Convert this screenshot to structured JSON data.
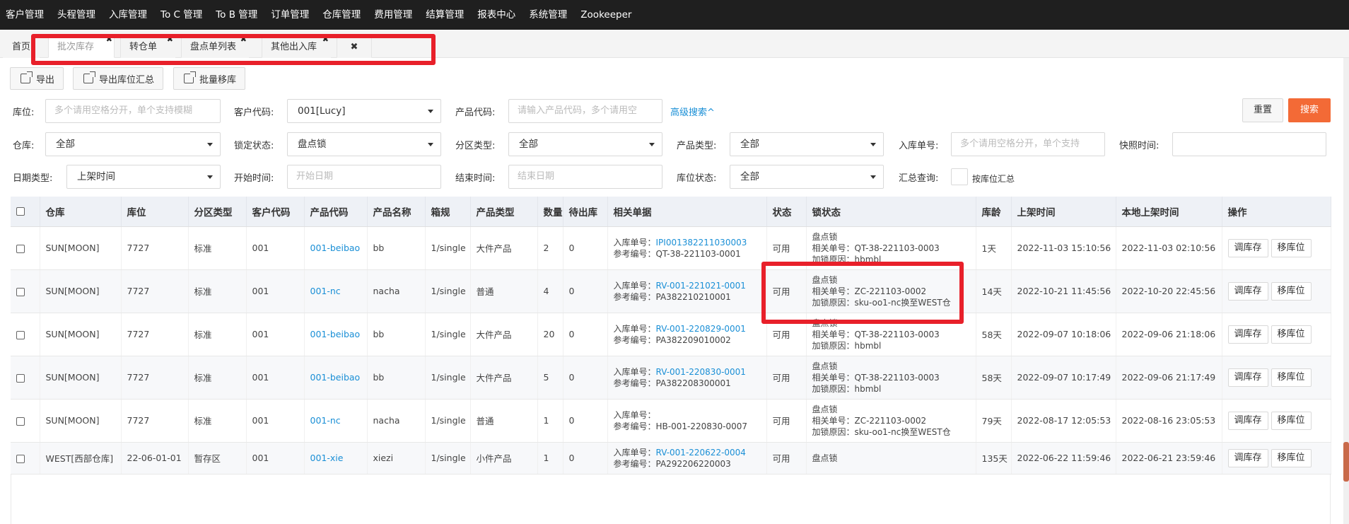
{
  "nav": [
    "客户管理",
    "头程管理",
    "入库管理",
    "To C 管理",
    "To B 管理",
    "订单管理",
    "仓库管理",
    "费用管理",
    "结算管理",
    "报表中心",
    "系统管理",
    "Zookeeper"
  ],
  "tabs": {
    "home": "首页",
    "items": [
      "批次库存",
      "转仓单",
      "盘点单列表",
      "其他出入库"
    ],
    "close_glyph": "✖"
  },
  "toolbar": {
    "export": "导出",
    "export_summary": "导出库位汇总",
    "batch_move": "批量移库"
  },
  "filters": {
    "location_label": "库位:",
    "location_placeholder": "多个请用空格分开，单个支持模糊",
    "customer_label": "客户代码:",
    "customer_value": "001[Lucy]",
    "product_code_label": "产品代码:",
    "product_code_placeholder": "请输入产品代码，多个请用空",
    "advanced_search": "高级搜索^",
    "reset": "重置",
    "search": "搜索",
    "warehouse_label": "仓库:",
    "warehouse_value": "全部",
    "lock_status_label": "锁定状态:",
    "lock_status_value": "盘点锁",
    "zone_type_label": "分区类型:",
    "zone_type_value": "全部",
    "product_type_label": "产品类型:",
    "product_type_value": "全部",
    "inbound_no_label": "入库单号:",
    "inbound_no_placeholder": "多个请用空格分开，单个支持",
    "snapshot_label": "快照时间:",
    "date_type_label": "日期类型:",
    "date_type_value": "上架时间",
    "start_label": "开始时间:",
    "start_placeholder": "开始日期",
    "end_label": "结束时间:",
    "end_placeholder": "结束日期",
    "loc_status_label": "库位状态:",
    "loc_status_value": "全部",
    "summary_label": "汇总查询:",
    "summary_option": "按库位汇总"
  },
  "table": {
    "headers": [
      "仓库",
      "库位",
      "分区类型",
      "客户代码",
      "产品代码",
      "产品名称",
      "箱规",
      "产品类型",
      "数量",
      "待出库",
      "相关单据",
      "状态",
      "锁状态",
      "库龄",
      "上架时间",
      "本地上架时间",
      "操作"
    ],
    "op_adjust": "调库存",
    "op_move": "移库位",
    "rows": [
      {
        "warehouse": "SUN[MOON]",
        "location": "7727",
        "zone": "标准",
        "customer": "001",
        "product_code": "001-beibao",
        "product_name": "bb",
        "box": "1/single",
        "product_type": "大件产品",
        "qty": "2",
        "pending": "0",
        "doc_in_label": "入库单号：",
        "doc_in": "IPI001382211030003",
        "doc_ref": "参考编号：QT-38-221103-0001",
        "status": "可用",
        "lock1": "盘点锁",
        "lock2": "相关单号：QT-38-221103-0003",
        "lock3": "加锁原因：hbmbl",
        "age": "1天",
        "shelf_time": "2022-11-03 15:10:56",
        "local_time": "2022-11-03 02:10:56"
      },
      {
        "warehouse": "SUN[MOON]",
        "location": "7727",
        "zone": "标准",
        "customer": "001",
        "product_code": "001-nc",
        "product_name": "nacha",
        "box": "1/single",
        "product_type": "普通",
        "qty": "4",
        "pending": "0",
        "doc_in_label": "入库单号：",
        "doc_in": "RV-001-221021-0001",
        "doc_ref": "参考编号：PA382210210001",
        "status": "可用",
        "lock1": "盘点锁",
        "lock2": "相关单号：ZC-221103-0002",
        "lock3": "加锁原因：sku-oo1-nc换至WEST仓",
        "age": "14天",
        "shelf_time": "2022-10-21 11:45:56",
        "local_time": "2022-10-20 22:45:56"
      },
      {
        "warehouse": "SUN[MOON]",
        "location": "7727",
        "zone": "标准",
        "customer": "001",
        "product_code": "001-beibao",
        "product_name": "bb",
        "box": "1/single",
        "product_type": "大件产品",
        "qty": "20",
        "pending": "0",
        "doc_in_label": "入库单号：",
        "doc_in": "RV-001-220829-0001",
        "doc_ref": "参考编号：PA382209010002",
        "status": "可用",
        "lock1": "盘点锁",
        "lock2": "相关单号：QT-38-221103-0003",
        "lock3": "加锁原因：hbmbl",
        "age": "58天",
        "shelf_time": "2022-09-07 10:18:06",
        "local_time": "2022-09-06 21:18:06"
      },
      {
        "warehouse": "SUN[MOON]",
        "location": "7727",
        "zone": "标准",
        "customer": "001",
        "product_code": "001-beibao",
        "product_name": "bb",
        "box": "1/single",
        "product_type": "大件产品",
        "qty": "5",
        "pending": "0",
        "doc_in_label": "入库单号：",
        "doc_in": "RV-001-220830-0001",
        "doc_ref": "参考编号：PA382208300001",
        "status": "可用",
        "lock1": "盘点锁",
        "lock2": "相关单号：QT-38-221103-0003",
        "lock3": "加锁原因：hbmbl",
        "age": "58天",
        "shelf_time": "2022-09-07 10:17:49",
        "local_time": "2022-09-06 21:17:49"
      },
      {
        "warehouse": "SUN[MOON]",
        "location": "7727",
        "zone": "标准",
        "customer": "001",
        "product_code": "001-nc",
        "product_name": "nacha",
        "box": "1/single",
        "product_type": "普通",
        "qty": "1",
        "pending": "0",
        "doc_in_label": "入库单号：",
        "doc_in": "",
        "doc_ref": "参考编号：HB-001-220830-0007",
        "status": "可用",
        "lock1": "盘点锁",
        "lock2": "相关单号：ZC-221103-0002",
        "lock3": "加锁原因：sku-oo1-nc换至WEST仓",
        "age": "79天",
        "shelf_time": "2022-08-17 12:05:53",
        "local_time": "2022-08-16 23:05:53"
      },
      {
        "warehouse": "WEST[西部仓库]",
        "location": "22-06-01-01",
        "zone": "暂存区",
        "customer": "001",
        "product_code": "001-xie",
        "product_name": "xiezi",
        "box": "1/single",
        "product_type": "小件产品",
        "qty": "1",
        "pending": "0",
        "doc_in_label": "入库单号：",
        "doc_in": "RV-001-220622-0004",
        "doc_ref": "参考编号：PA292206220003",
        "status": "可用",
        "lock1": "盘点锁",
        "lock2": "",
        "lock3": "",
        "age": "135天",
        "shelf_time": "2022-06-22 11:59:46",
        "local_time": "2022-06-21 23:59:46"
      }
    ]
  },
  "colors": {
    "topnav": "#1f1f1f",
    "highlight": "#e8202a",
    "link": "#1a8fd6",
    "primary_button": "#f36a36"
  }
}
